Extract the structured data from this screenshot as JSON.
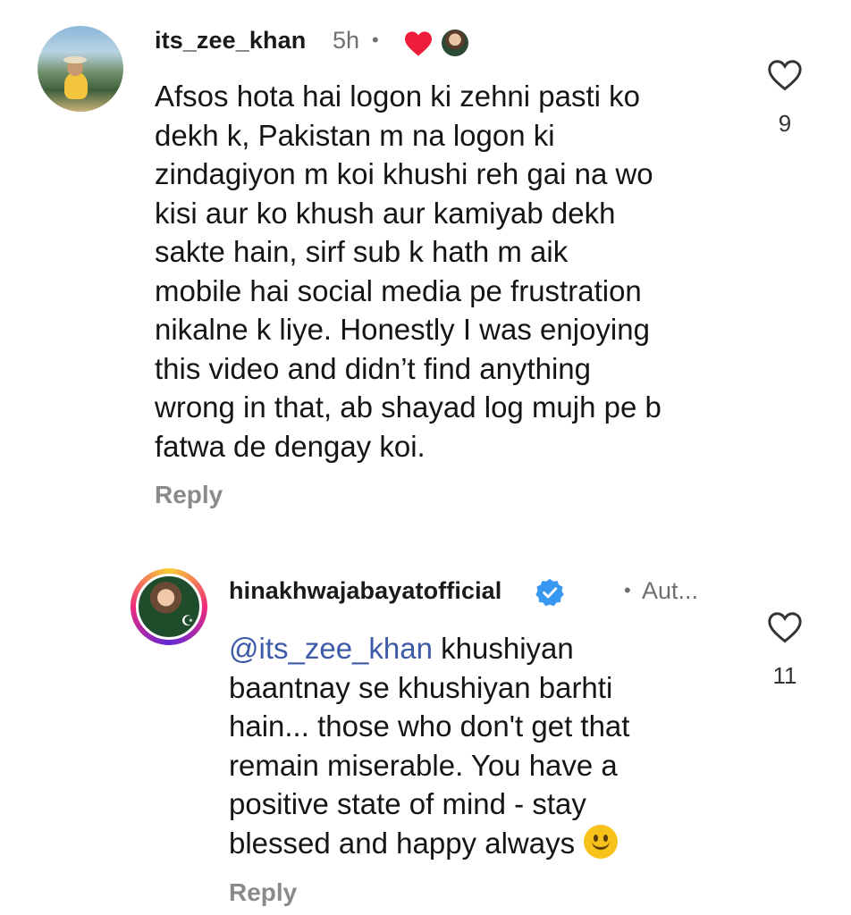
{
  "comments": [
    {
      "username": "its_zee_khan",
      "time": "5h",
      "separator": "•",
      "body": "Afsos hota hai logon ki zehni pasti ko dekh k, Pakistan m na logon ki zindagiyon m koi khushi reh gai na wo kisi aur ko khush aur kamiyab dekh sakte hain, sirf sub k hath m aik mobile hai social media pe frustration nikalne k liye. Honestly I was enjoying this video and didn’t find anything wrong in that, ab shayad log mujh pe b fatwa de dengay koi.",
      "body_lines": [
        "Afsos hota hai logon ki zehni pasti ko",
        "dekh k, Pakistan m na logon ki",
        "zindagiyon m koi khushi reh gai na wo",
        "kisi aur ko khush aur kamiyab dekh",
        "sakte hain, sirf sub k hath m aik",
        "mobile hai social media pe frustration",
        "nikalne k liye. Honestly I was enjoying",
        "this video and didn’t find anything",
        "wrong in that, ab shayad log mujh pe b",
        "fatwa de dengay koi."
      ],
      "reply_label": "Reply",
      "like_count": "9",
      "liked_by_author": true,
      "icons": {
        "like": "heart-outline-icon",
        "author_like": "heart-filled-icon"
      }
    },
    {
      "username": "hinakhwajabayatofficial",
      "verified": true,
      "separator": "•",
      "author_label": "Aut...",
      "mention": "@its_zee_khan",
      "body_lines": [
        " khushiyan",
        "baantnay se khushiyan barhti",
        "hain... those who don't get that",
        "remain miserable. You have a",
        "positive state of mind - stay",
        "blessed and happy always"
      ],
      "emoji": "slightly-smiling-face",
      "reply_label": "Reply",
      "like_count": "11",
      "icons": {
        "like": "heart-outline-icon",
        "verified": "verified-badge-icon"
      }
    }
  ],
  "colors": {
    "heart_red": "#ed1c3a",
    "verified_blue": "#3897f0",
    "mention_blue": "#3d5aa8",
    "muted_gray": "#8a8a8a"
  }
}
